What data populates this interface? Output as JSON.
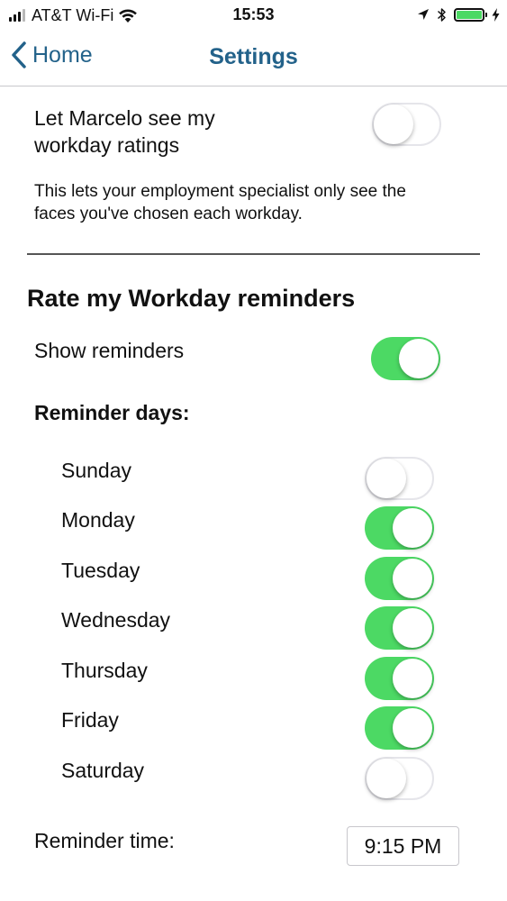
{
  "status_bar": {
    "carrier": "AT&T Wi-Fi",
    "time": "15:53",
    "icons": [
      "signal-bars",
      "wifi-icon",
      "location-arrow-icon",
      "bluetooth-icon",
      "battery-icon",
      "charging-bolt-icon"
    ],
    "battery_level": 1.0
  },
  "nav": {
    "back_label": "Home",
    "title": "Settings",
    "accent_color": "#23628a"
  },
  "share": {
    "label_line1": "Let Marcelo see my",
    "label_line2": "workday ratings",
    "enabled": false,
    "description_line1": "This lets your employment specialist only see the",
    "description_line2": "faces you've chosen each workday."
  },
  "reminders": {
    "heading": "Rate my Workday reminders",
    "show_label": "Show reminders",
    "show_enabled": true,
    "days_heading": "Reminder days:",
    "days": [
      {
        "label": "Sunday",
        "enabled": false
      },
      {
        "label": "Monday",
        "enabled": true
      },
      {
        "label": "Tuesday",
        "enabled": true
      },
      {
        "label": "Wednesday",
        "enabled": true
      },
      {
        "label": "Thursday",
        "enabled": true
      },
      {
        "label": "Friday",
        "enabled": true
      },
      {
        "label": "Saturday",
        "enabled": false
      }
    ],
    "time_label": "Reminder time:",
    "time_value": "9:15 PM"
  },
  "colors": {
    "toggle_on": "#4cd964",
    "toggle_off_border": "#e5e5ea"
  }
}
